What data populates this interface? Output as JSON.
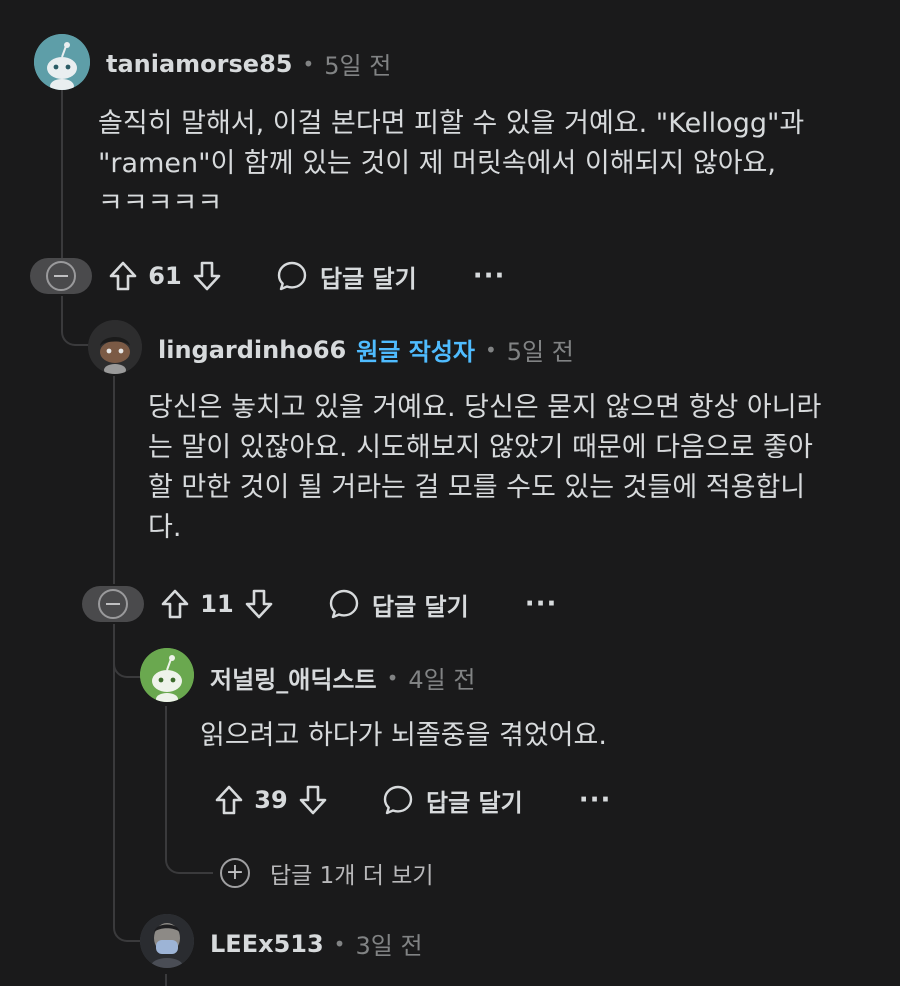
{
  "comments": [
    {
      "username": "taniamorse85",
      "time": "5일 전",
      "lines": [
        "솔직히 말해서, 이걸 본다면 피할 수 있을 거예요. \"Kellogg\"과",
        "\"ramen\"이 함께 있는 것이 제 머릿속에서 이해되지 않아요,",
        "ㅋㅋㅋㅋㅋ"
      ],
      "score": "61",
      "reply_label": "답글 달기",
      "more_label": "···"
    },
    {
      "username": "lingardinho66",
      "op_badge": "원글 작성자",
      "time": "5일 전",
      "lines": [
        "당신은 놓치고 있을 거예요. 당신은 묻지 않으면 항상 아니라",
        "는 말이 있잖아요. 시도해보지 않았기 때문에 다음으로 좋아",
        "할 만한 것이 될 거라는 걸 모를 수도 있는 것들에 적용합니",
        "다."
      ],
      "score": "11",
      "reply_label": "답글 달기",
      "more_label": "···"
    },
    {
      "username": "저널링_애딕스트",
      "time": "4일 전",
      "lines": [
        "읽으려고 하다가 뇌졸중을 겪었어요."
      ],
      "score": "39",
      "reply_label": "답글 달기",
      "more_label": "···",
      "more_replies_label": "답글 1개 더 보기"
    },
    {
      "username": "LEEx513",
      "time": "3일 전"
    }
  ],
  "separator": "•",
  "colors": {
    "background": "#1a1a1b",
    "text": "#d7dadc",
    "muted": "#818384",
    "op_badge": "#4fbcff",
    "thread_line": "#3a3a3c"
  },
  "icons": [
    "collapse-icon",
    "upvote-icon",
    "downvote-icon",
    "reply-bubble-icon",
    "more-icon",
    "plus-circle-icon"
  ]
}
